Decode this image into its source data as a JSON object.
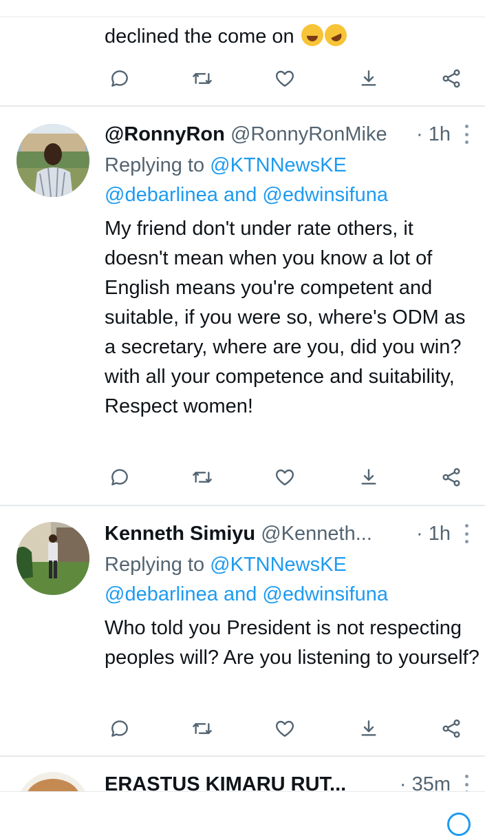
{
  "tweets": [
    {
      "text": "declined the come on",
      "emoji": [
        "face-with-tears-of-joy",
        "rolling-on-the-floor-laughing"
      ]
    },
    {
      "name": "@RonnyRon",
      "handle": "@RonnyRonMike",
      "time": "· 1h",
      "replying_prefix": "Replying to",
      "replying_1": "@KTNNewsKE",
      "replying_2": "@debarlinea",
      "replying_and": "and",
      "replying_3": "@edwinsifuna",
      "text": "My friend don't under rate others, it doesn't mean when you know a lot of English means you're competent and suitable, if you were so, where's ODM as a secretary, where are you, did you win? with all your competence and suitability, Respect women!"
    },
    {
      "name": "Kenneth Simiyu",
      "handle": "@Kenneth...",
      "time": "· 1h",
      "replying_prefix": "Replying to",
      "replying_1": "@KTNNewsKE",
      "replying_2": "@debarlinea",
      "replying_and": "and",
      "replying_3": "@edwinsifuna",
      "text": "Who told you President is not respecting peoples will? Are you listening to yourself?"
    },
    {
      "name": "ERASTUS KIMARU RUT...",
      "time": "· 35m"
    }
  ],
  "icons": [
    "reply-icon",
    "retweet-icon",
    "like-icon",
    "share-icon",
    "analytics-icon"
  ],
  "colors": {
    "link": "#1d9bf0",
    "muted": "#536471",
    "text": "#0f1419",
    "divider": "#e6e9ec"
  }
}
